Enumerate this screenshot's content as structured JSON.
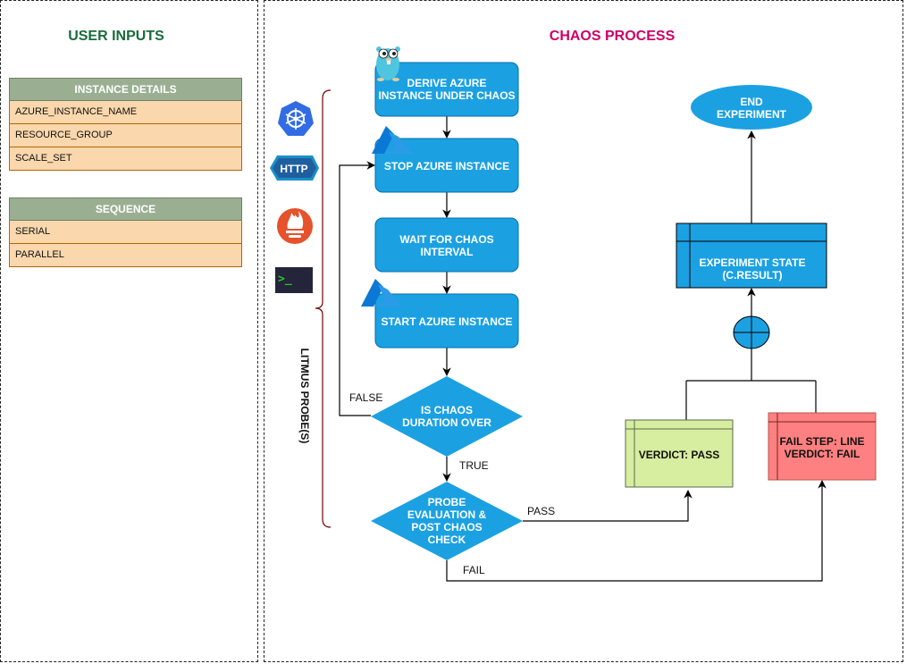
{
  "user_inputs": {
    "title": "USER INPUTS",
    "instance_details": {
      "header": "INSTANCE DETAILS",
      "rows": [
        "AZURE_INSTANCE_NAME",
        "RESOURCE_GROUP",
        "SCALE_SET"
      ]
    },
    "sequence": {
      "header": "SEQUENCE",
      "rows": [
        "SERIAL",
        "PARALLEL"
      ]
    }
  },
  "chaos_process": {
    "title": "CHAOS PROCESS",
    "probes": {
      "label": "LITMUS PROBE(S)",
      "icons": [
        "kubernetes-icon",
        "http-icon",
        "prometheus-icon",
        "cmd-terminal-icon"
      ],
      "http_text": "HTTP",
      "terminal_text": ">_"
    },
    "steps": {
      "derive": [
        "DERIVE AZURE",
        "INSTANCE UNDER CHAOS"
      ],
      "stop": "STOP AZURE INSTANCE",
      "wait": [
        "WAIT FOR CHAOS",
        "INTERVAL"
      ],
      "start": "START AZURE INSTANCE",
      "decision_duration": [
        "IS CHAOS",
        "DURATION OVER"
      ],
      "decision_probe": [
        "PROBE",
        "EVALUATION &",
        "POST CHAOS",
        "CHECK"
      ],
      "verdict_pass": "VERDICT: PASS",
      "verdict_fail": [
        "FAIL STEP: LINE",
        "VERDICT: FAIL"
      ],
      "experiment_state": [
        "EXPERIMENT STATE",
        "(C.RESULT)"
      ],
      "end": [
        "END",
        "EXPERIMENT"
      ]
    },
    "edge_labels": {
      "false": "FALSE",
      "true": "TRUE",
      "pass": "PASS",
      "fail": "FAIL"
    }
  },
  "colors": {
    "process_blue": "#1ba1e2",
    "process_border": "#006eaf",
    "user_title_green": "#1a6b3c",
    "chaos_title_magenta": "#cc0066",
    "table_header": "#9aaf92",
    "table_row": "#fad7ac",
    "pass_fill": "#d7ed9f",
    "fail_fill": "#ff8080",
    "brace": "#6f0000"
  }
}
